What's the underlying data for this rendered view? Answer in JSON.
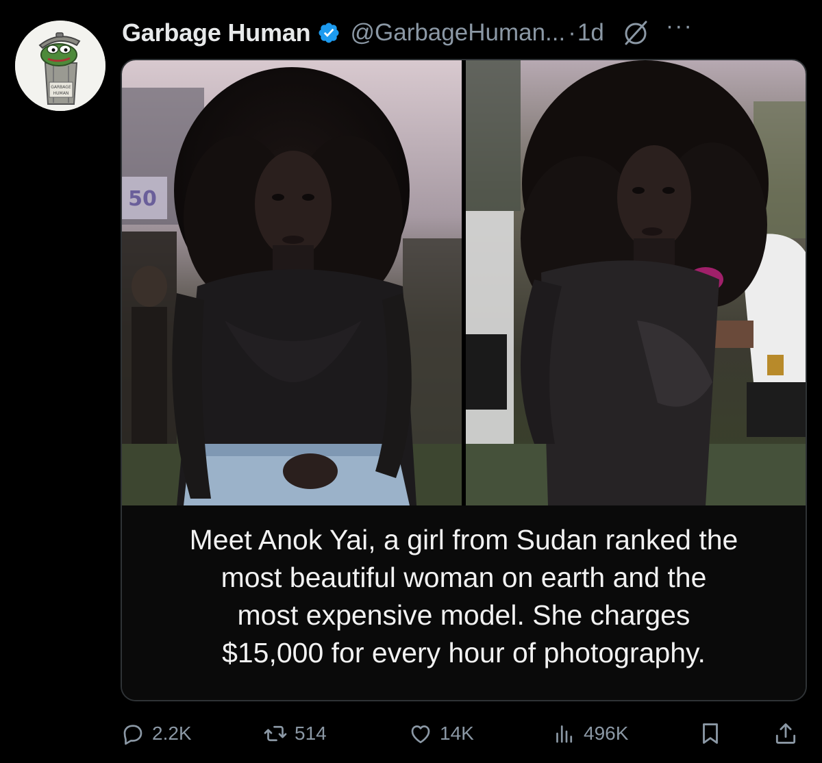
{
  "author": {
    "display_name": "Garbage Human",
    "handle": "@GarbageHuman...",
    "separator": "·",
    "time": "1d",
    "verified": true,
    "avatar_text_line1": "GARBAGE",
    "avatar_text_line2": "HUMAN"
  },
  "icons": {
    "verified": "verified-badge-icon",
    "grok": "grok-icon",
    "more": "more-icon",
    "reply": "reply-icon",
    "repost": "repost-icon",
    "like": "like-icon",
    "views": "views-icon",
    "bookmark": "bookmark-icon",
    "share": "share-icon"
  },
  "more_label": "···",
  "media": {
    "caption_lines": [
      "Meet Anok Yai, a girl from Sudan ranked the",
      "most beautiful woman on earth and the",
      "most expensive model. She charges",
      "$15,000 for every hour of photography."
    ],
    "sign_text": "50"
  },
  "actions": {
    "reply_count": "2.2K",
    "repost_count": "514",
    "like_count": "14K",
    "views_count": "496K"
  },
  "colors": {
    "background": "#000000",
    "text_primary": "#e7e9ea",
    "text_secondary": "#8b98a5",
    "verified_blue": "#1d9bf0",
    "border": "#2f3336"
  }
}
